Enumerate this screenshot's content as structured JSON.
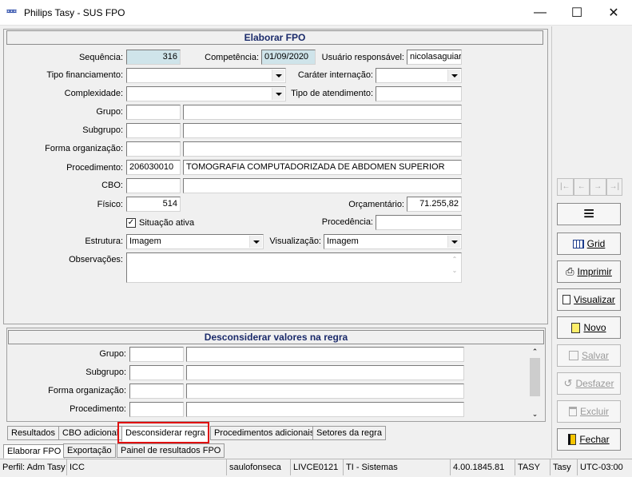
{
  "window": {
    "icon_label": "¤¤¤",
    "title": "Philips Tasy - SUS FPO",
    "minimize": "—",
    "maximize": "☐",
    "close": "✕"
  },
  "main_panel": {
    "header": "Elaborar FPO",
    "sequencia_label": "Sequência:",
    "sequencia_value": "316",
    "competencia_label": "Competência:",
    "competencia_value": "01/09/2020",
    "usuario_label": "Usuário responsável:",
    "usuario_value": "nicolasaguiar",
    "tipo_fin_label": "Tipo financiamento:",
    "tipo_fin_value": "",
    "carater_label": "Caráter internação:",
    "carater_value": "",
    "complexidade_label": "Complexidade:",
    "complexidade_value": "",
    "tipo_atend_label": "Tipo de atendimento:",
    "tipo_atend_value": "",
    "grupo_label": "Grupo:",
    "grupo_code": "",
    "grupo_desc": "",
    "subgrupo_label": "Subgrupo:",
    "subgrupo_code": "",
    "subgrupo_desc": "",
    "forma_label": "Forma organização:",
    "forma_code": "",
    "forma_desc": "",
    "procedimento_label": "Procedimento:",
    "procedimento_code": "206030010",
    "procedimento_desc": "TOMOGRAFIA COMPUTADORIZADA DE ABDOMEN SUPERIOR",
    "cbo_label": "CBO:",
    "cbo_code": "",
    "cbo_desc": "",
    "fisico_label": "Físico:",
    "fisico_value": "514",
    "orcamentario_label": "Orçamentário:",
    "orcamentario_value": "71.255,82",
    "situacao_label": "Situação ativa",
    "situacao_checked": true,
    "procedencia_label": "Procedência:",
    "procedencia_value": "",
    "estrutura_label": "Estrutura:",
    "estrutura_value": "Imagem",
    "visualizacao_label": "Visualização:",
    "visualizacao_value": "Imagem",
    "observacoes_label": "Observações:",
    "observacoes_value": ""
  },
  "sub_panel": {
    "header": "Desconsiderar valores na regra",
    "grupo_label": "Grupo:",
    "subgrupo_label": "Subgrupo:",
    "forma_label": "Forma organização:",
    "procedimento_label": "Procedimento:"
  },
  "side_buttons": {
    "menu_icon": "≡",
    "grid": "Grid",
    "imprimir": "Imprimir",
    "visualizar": "Visualizar",
    "novo": "Novo",
    "salvar": "Salvar",
    "desfazer": "Desfazer",
    "excluir": "Excluir",
    "fechar": "Fechar"
  },
  "inner_tabs": [
    "Resultados",
    "CBO adicional",
    "Desconsiderar regra",
    "Procedimentos adicionais",
    "Setores da regra"
  ],
  "inner_tab_active": "Desconsiderar regra",
  "outer_tabs": [
    "Elaborar FPO",
    "Exportação",
    "Painel de resultados FPO"
  ],
  "status_bar": {
    "perfil": "Perfil: Adm Tasy",
    "icc": "ICC",
    "user": "saulofonseca",
    "station": "LIVCE0121",
    "dept": "TI - Sistemas",
    "version": "4.00.1845.81",
    "app": "TASY",
    "db": "Tasy",
    "tz": "UTC-03:00"
  },
  "colors": {
    "readonly_field": "#cfe4ea",
    "highlight_box": "#e01010",
    "header_text": "#1a2a6a"
  }
}
